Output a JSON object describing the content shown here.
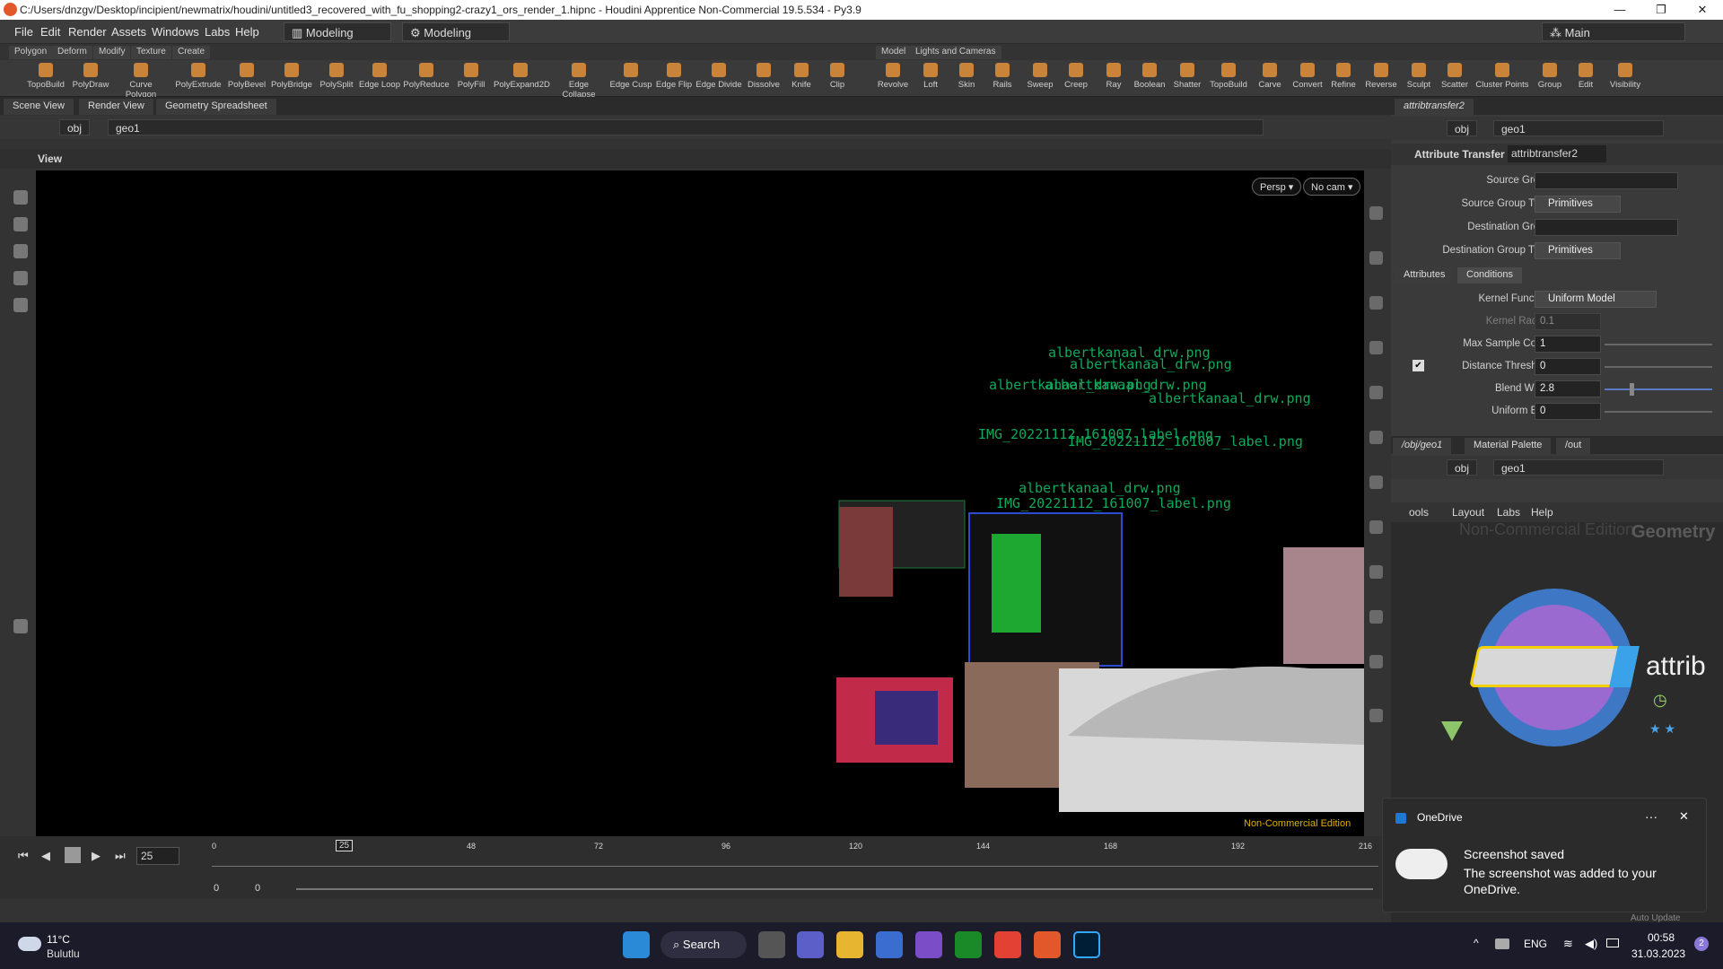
{
  "window": {
    "title": "C:/Users/dnzgv/Desktop/incipient/newmatrix/houdini/untitled3_recovered_with_fu_shopping2-crazy1_ors_render_1.hipnc - Houdini Apprentice Non-Commercial 19.5.534 - Py3.9",
    "minimize": "—",
    "maximize": "❐",
    "close": "✕"
  },
  "menu": {
    "items": [
      "File",
      "Edit",
      "Render",
      "Assets",
      "Windows",
      "Labs",
      "Help"
    ],
    "desktop": "Modeling",
    "desktop2": "Modeling",
    "main_desk": "Main"
  },
  "shelf_tabs_left": [
    "Polygon",
    "Deform",
    "Modify",
    "Texture",
    "Create"
  ],
  "shelf_tabs_right": [
    "Model",
    "Lights and Cameras"
  ],
  "shelf_tools_left": [
    "TopoBuild",
    "PolyDraw",
    "Curve Polygon",
    "PolyExtrude",
    "PolyBevel",
    "PolyBridge",
    "PolySplit",
    "Edge Loop",
    "PolyReduce",
    "PolyFill",
    "PolyExpand2D",
    "Edge Collapse",
    "Edge Cusp",
    "Edge Flip",
    "Edge Divide",
    "Dissolve",
    "Knife",
    "Clip"
  ],
  "shelf_tools_right": [
    "Revolve",
    "Loft",
    "Skin",
    "Rails",
    "Sweep",
    "Creep",
    "Ray",
    "Boolean",
    "Shatter",
    "TopoBuild",
    "Carve",
    "Convert",
    "Refine",
    "Reverse",
    "Sculpt",
    "Scatter",
    "Cluster Points",
    "Group",
    "Edit",
    "Visibility"
  ],
  "left_pane": {
    "tabs": [
      "Scene View",
      "Render View",
      "Geometry Spreadsheet"
    ],
    "path": [
      "obj",
      "geo1"
    ],
    "view_label": "View",
    "persp": "Persp ▾",
    "cam": "No cam ▾",
    "watermark": "Non-Commercial Edition",
    "overlays": [
      "albertkanaal_drw.png",
      "albertkanaal_drw.png",
      "albertkanaal_drw.png",
      "albertkanaal_drw.png",
      "albertkanaal_drw.png",
      "IMG_20221112_161007_label.png",
      "IMG_20221112_161007_label.png",
      "albertkanaal_drw.png",
      "IMG_20221112_161007_label.png"
    ]
  },
  "timeline": {
    "frame": "25",
    "current_marker": "25",
    "ticks": [
      "0",
      "48",
      "72",
      "96",
      "120",
      "144",
      "168",
      "192",
      "216"
    ],
    "range_start": "0",
    "range_end": "0"
  },
  "right_pane": {
    "tab": "attribtransfer2",
    "path": [
      "obj",
      "geo1"
    ],
    "node_type": "Attribute Transfer",
    "node_name": "attribtransfer2",
    "params_top": [
      {
        "label": "Source Group",
        "value": ""
      },
      {
        "label": "Source Group Type",
        "value": "Primitives"
      },
      {
        "label": "Destination Group",
        "value": ""
      },
      {
        "label": "Destination Group Type",
        "value": "Primitives"
      }
    ],
    "subtabs": [
      "Attributes",
      "Conditions"
    ],
    "params_cond": [
      {
        "label": "Kernel Function",
        "value": "Uniform Model"
      },
      {
        "label": "Kernel Radius",
        "value": "0.1"
      },
      {
        "label": "Max Sample Count",
        "value": "1"
      },
      {
        "label": "Distance Threshold",
        "value": "0"
      },
      {
        "label": "Blend Width",
        "value": "2.8"
      },
      {
        "label": "Uniform Bias",
        "value": "0"
      }
    ],
    "net_tabs": [
      "/obj/geo1",
      "Material Palette",
      "/out"
    ],
    "net_path": [
      "obj",
      "geo1"
    ],
    "net_menu": [
      "ools",
      "Layout",
      "Labs",
      "Help"
    ],
    "net_watermark": "Non-Commercial Edition",
    "net_context": "Geometry",
    "node_label": "attrib"
  },
  "toast": {
    "app": "OneDrive",
    "title": "Screenshot saved",
    "body": "The screenshot was added to your OneDrive.",
    "more": "···",
    "close": "✕",
    "behind": "Auto Update"
  },
  "taskbar": {
    "weather_temp": "11°C",
    "weather_desc": "Bulutlu",
    "search": "Search",
    "lang": "ENG",
    "time": "00:58",
    "date": "31.03.2023",
    "badge": "2"
  }
}
